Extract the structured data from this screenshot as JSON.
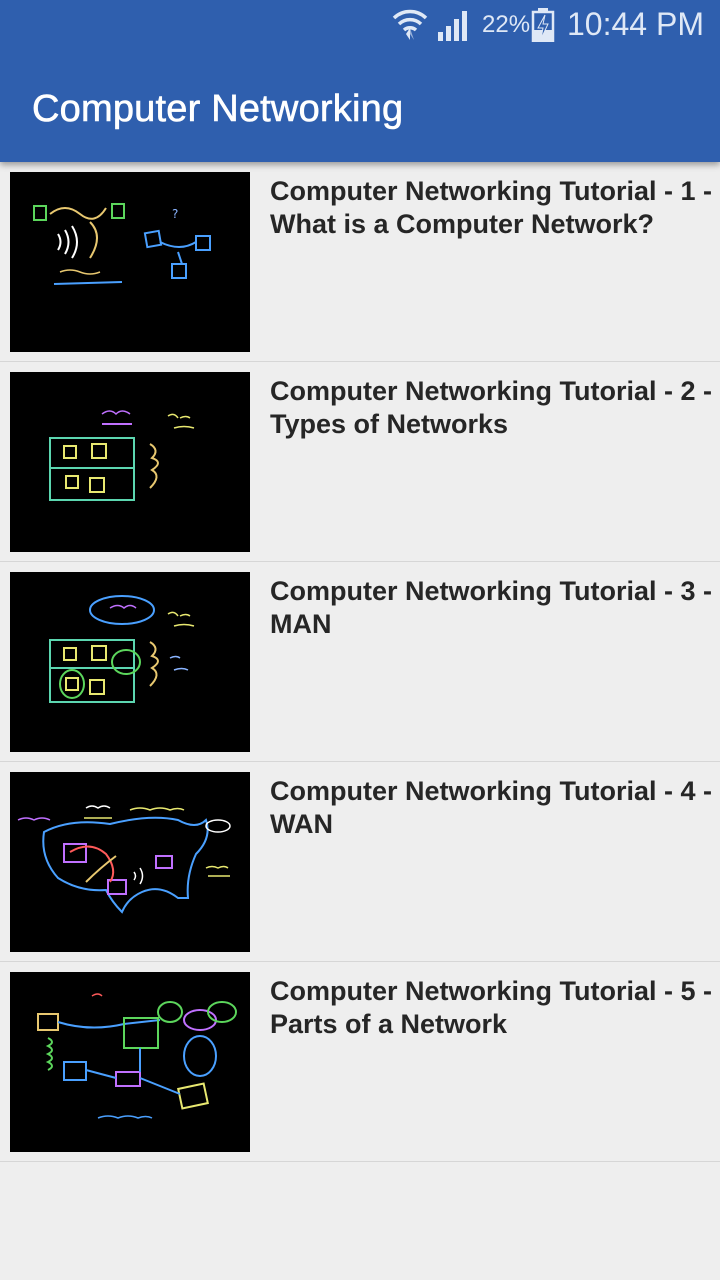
{
  "status_bar": {
    "battery_percent": "22%",
    "time": "10:44 PM",
    "icons": [
      "wifi-icon",
      "signal-icon",
      "battery-charging-icon"
    ]
  },
  "app_bar": {
    "title": "Computer Networking",
    "color": "#2f5fae"
  },
  "videos": [
    {
      "title": "Computer Networking Tutorial - 1 - What is a Computer Network?"
    },
    {
      "title": "Computer Networking Tutorial - 2 - Types of Networks"
    },
    {
      "title": "Computer Networking Tutorial - 3 - MAN"
    },
    {
      "title": "Computer Networking Tutorial - 4 - WAN"
    },
    {
      "title": "Computer Networking Tutorial - 5 - Parts of a Network"
    }
  ]
}
